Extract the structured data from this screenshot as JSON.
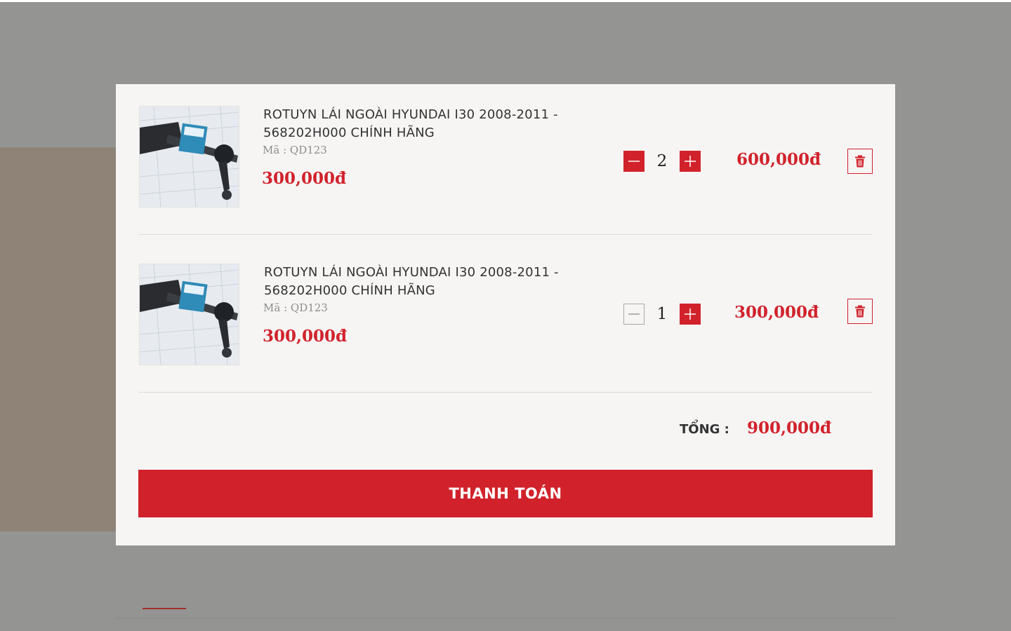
{
  "modal": {
    "items": [
      {
        "name": "ROTUYN LÁI NGOÀI HYUNDAI I30 2008-2011 - 568202H000 CHÍNH HÃNG",
        "code": "Mã : QD123",
        "price": "300,000đ",
        "quantity": "2",
        "line_total": "600,000đ",
        "minus_state": "active",
        "image_icon": "product-photo-icon"
      },
      {
        "name": "ROTUYN LÁI NGOÀI HYUNDAI I30 2008-2011 - 568202H000 CHÍNH HÃNG",
        "code": "Mã : QD123",
        "price": "300,000đ",
        "quantity": "1",
        "line_total": "300,000đ",
        "minus_state": "inactive",
        "image_icon": "product-photo-icon"
      }
    ],
    "total_label": "TỔNG :",
    "total_value": "900,000đ",
    "checkout_label": "THANH TOÁN"
  },
  "colors": {
    "accent": "#d1222b",
    "overlay": "#949492",
    "modal_bg": "#f6f5f4"
  },
  "icons": [
    "minus-icon",
    "plus-icon",
    "trash-icon",
    "product-photo-icon"
  ]
}
